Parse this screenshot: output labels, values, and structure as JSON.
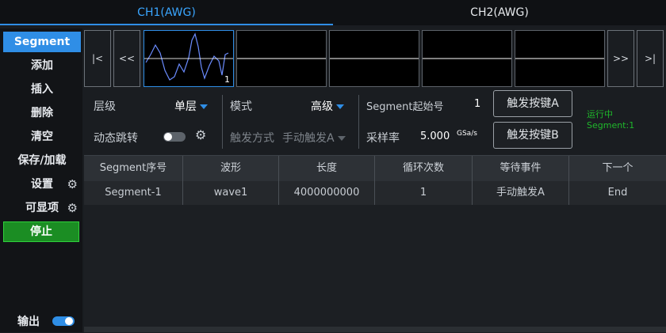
{
  "tabs": [
    {
      "label": "CH1(AWG)",
      "active": true
    },
    {
      "label": "CH2(AWG)",
      "active": false
    }
  ],
  "sidebar": {
    "items": [
      {
        "label": "Segment",
        "active": true
      },
      {
        "label": "添加"
      },
      {
        "label": "插入"
      },
      {
        "label": "删除"
      },
      {
        "label": "清空"
      },
      {
        "label": "保存/加载"
      },
      {
        "label": "设置",
        "icon": "gear-icon"
      },
      {
        "label": "可显项",
        "icon": "gear-icon"
      },
      {
        "label": "停止",
        "color": "#1b8d23"
      }
    ],
    "output_label": "输出",
    "output_on": true
  },
  "segment_nav": {
    "first": "|<",
    "prev": "<<",
    "next": ">>",
    "last": ">|",
    "selected_thumb_number": "1"
  },
  "settings": {
    "level_label": "层级",
    "level_value": "单层",
    "mode_label": "模式",
    "mode_value": "高级",
    "segment_start_label": "Segment起始号",
    "segment_start_value": "1",
    "trigger_a_button": "触发按键A",
    "trigger_b_button": "触发按键B",
    "dynamic_jump_label": "动态跳转",
    "dynamic_jump_on": false,
    "trigger_mode_label": "触发方式",
    "trigger_mode_value": "手动触发A",
    "sample_rate_label": "采样率",
    "sample_rate_value": "5.000",
    "sample_rate_unit": "GSa/s",
    "status_running": "运行中",
    "status_segment": "Segment:1"
  },
  "table": {
    "headers": [
      "Segment序号",
      "波形",
      "长度",
      "循环次数",
      "等待事件",
      "下一个"
    ],
    "rows": [
      [
        "Segment-1",
        "wave1",
        "4000000000",
        "1",
        "手动触发A",
        "End"
      ]
    ]
  },
  "colors": {
    "accent": "#2f8ee6",
    "status_green": "#1fb82b",
    "stop_green": "#1b8d23"
  }
}
